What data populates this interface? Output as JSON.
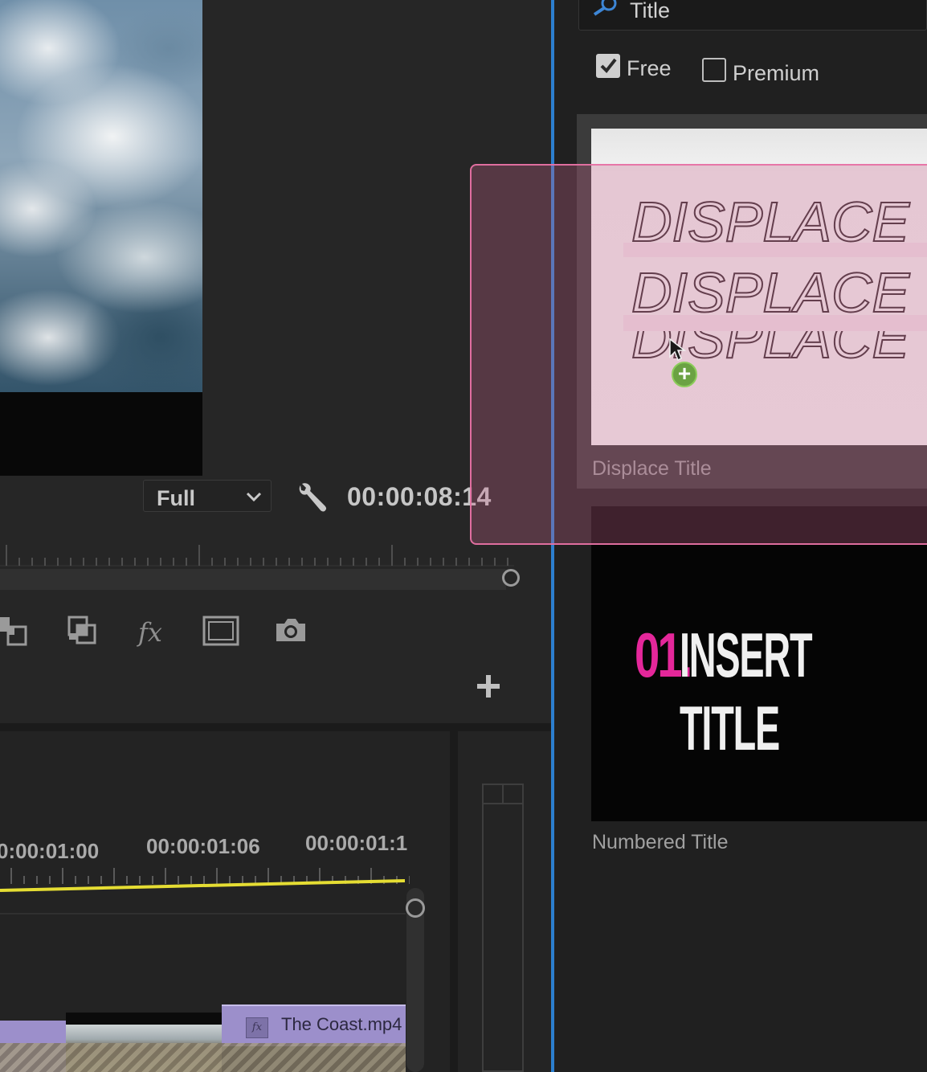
{
  "monitor": {
    "quality": "Full",
    "timecode": "00:00:08:14"
  },
  "timeline": {
    "timecodes": [
      "0:00:01:00",
      "00:00:01:06",
      "00:00:01:1"
    ],
    "clip_name": "The Coast.mp4",
    "clip_fx_label": "fx"
  },
  "essential_graphics": {
    "search": {
      "value": "Title"
    },
    "filters": {
      "free_label": "Free",
      "free_checked": true,
      "premium_label": "Premium",
      "premium_checked": false
    },
    "templates": [
      {
        "name": "Displace Title",
        "preview_text": "DISPLACE TI"
      },
      {
        "name": "Numbered Title",
        "preview_number": "01.",
        "preview_text": "INSERT TITLE"
      }
    ]
  },
  "colors": {
    "accent_blue": "#2c7fcf",
    "drag_pink": "#e772a4",
    "number_magenta": "#e4279a",
    "clip_purple": "#9c8fcb",
    "playhead_yellow": "#e5dd33",
    "add_green": "#6ba243"
  },
  "icons": [
    "wrench-icon",
    "chevron-down-icon",
    "search-icon",
    "checkbox-icon",
    "fx-icon",
    "camera-icon",
    "safe-margins-icon",
    "plus-icon",
    "cursor-icon",
    "add-badge-icon"
  ]
}
